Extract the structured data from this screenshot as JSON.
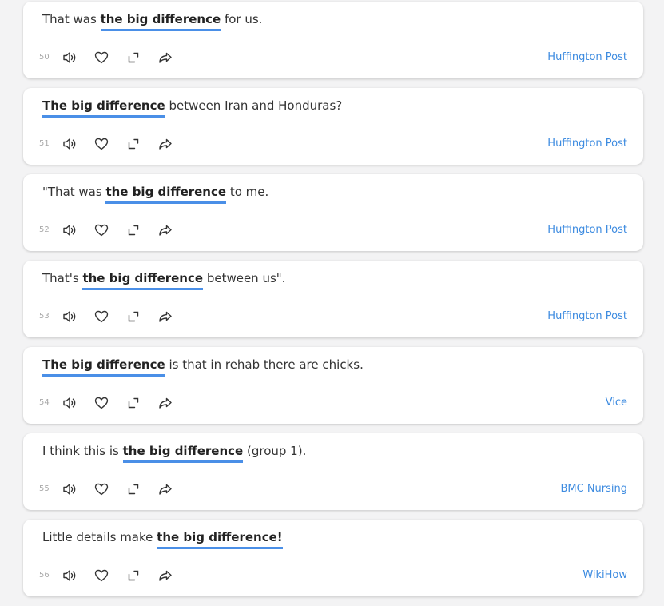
{
  "examples": [
    {
      "num": "50",
      "before": "That was ",
      "highlight": "the big difference",
      "after": " for us.",
      "source": "Huffington Post"
    },
    {
      "num": "51",
      "before": "",
      "highlight": "The big difference",
      "after": " between Iran and Honduras?",
      "source": "Huffington Post"
    },
    {
      "num": "52",
      "before": "\"That was ",
      "highlight": "the big difference",
      "after": " to me.",
      "source": "Huffington Post"
    },
    {
      "num": "53",
      "before": "That's ",
      "highlight": "the big difference",
      "after": " between us\".",
      "source": "Huffington Post"
    },
    {
      "num": "54",
      "before": "",
      "highlight": "The big difference",
      "after": " is that in rehab there are chicks.",
      "source": "Vice"
    },
    {
      "num": "55",
      "before": "I think this is ",
      "highlight": "the big difference",
      "after": " (group 1).",
      "source": "BMC Nursing"
    },
    {
      "num": "56",
      "before": "Little details make ",
      "highlight": "the big difference!",
      "after": "",
      "source": "WikiHow"
    }
  ],
  "icons": {
    "speaker": "speaker-icon",
    "heart": "heart-icon",
    "expand": "expand-icon",
    "share": "share-icon"
  },
  "colors": {
    "accent": "#4a8fe7",
    "link": "#3d8be0",
    "background": "#f3f3f4"
  }
}
